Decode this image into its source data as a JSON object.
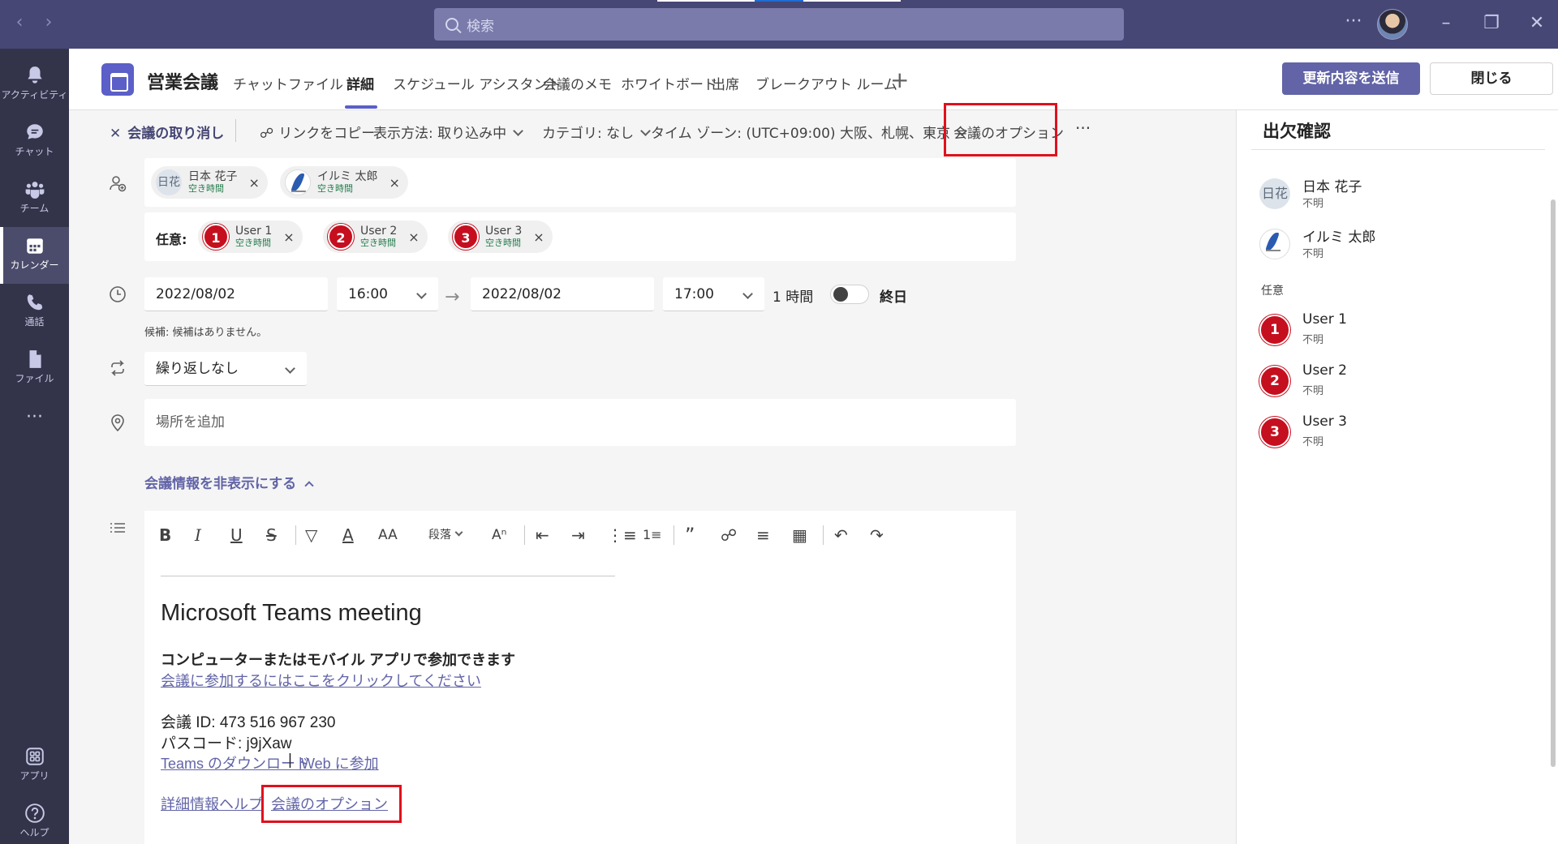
{
  "search": {
    "placeholder": "検索"
  },
  "rail": [
    {
      "label": "アクティビティ",
      "icon": "bell-icon"
    },
    {
      "label": "チャット",
      "icon": "chat-icon"
    },
    {
      "label": "チーム",
      "icon": "teams-icon"
    },
    {
      "label": "カレンダー",
      "icon": "calendar-icon"
    },
    {
      "label": "通話",
      "icon": "phone-icon"
    },
    {
      "label": "ファイル",
      "icon": "file-icon"
    },
    {
      "label": "アプリ",
      "icon": "apps-icon"
    },
    {
      "label": "ヘルプ",
      "icon": "help-icon"
    }
  ],
  "header": {
    "title": "営業会議",
    "tabs": [
      "チャット",
      "ファイル",
      "詳細",
      "スケジュール アシスタント",
      "会議のメモ",
      "ホワイトボード",
      "出席",
      "ブレークアウト ルーム"
    ],
    "active_tab": "詳細",
    "send_button": "更新内容を送信",
    "close_button": "閉じる"
  },
  "toolbar": {
    "cancel": "会議の取り消し",
    "copy_link": "リンクをコピー",
    "show_as": "表示方法: 取り込み中",
    "category": "カテゴリ: なし",
    "timezone": "タイム ゾーン: (UTC+09:00) 大阪、札幌、東京",
    "meeting_options": "会議のオプション",
    "more": "···"
  },
  "attendees": {
    "required": [
      {
        "initials": "日花",
        "name": "日本 花子",
        "status": "空き時間"
      },
      {
        "name": "イルミ 太郎",
        "status": "空き時間"
      }
    ],
    "optional_label": "任意:",
    "optional": [
      {
        "num": "1",
        "name": "User 1",
        "status": "空き時間"
      },
      {
        "num": "2",
        "name": "User 2",
        "status": "空き時間"
      },
      {
        "num": "3",
        "name": "User 3",
        "status": "空き時間"
      }
    ],
    "remove": "×"
  },
  "datetime": {
    "start_date": "2022/08/02",
    "start_time": "16:00",
    "arrow": "→",
    "end_date": "2022/08/02",
    "end_time": "17:00",
    "duration": "1 時間",
    "all_day": "終日",
    "all_day_on": false,
    "suggestion": "候補: 候補はありません。"
  },
  "repeat": {
    "value": "繰り返しなし"
  },
  "location": {
    "placeholder": "場所を追加"
  },
  "hide_info": "会議情報を非表示にする",
  "editor": {
    "paragraph": "段落",
    "meeting_title": "Microsoft Teams meeting",
    "join_desc": "コンピューターまたはモバイル アプリで参加できます",
    "join_link": "会議に参加するにはここをクリックしてください",
    "meeting_id": "会議 ID: 473 516 967 230",
    "passcode": "パスコード: j9jXaw",
    "download_link": "Teams のダウンロード",
    "pipe": "|",
    "web_link": "Web に参加",
    "help_link": "詳細情報ヘルプ",
    "options_link": "会議のオプション"
  },
  "rsvp": {
    "title": "出欠確認",
    "required": [
      {
        "initials": "日花",
        "name": "日本 花子",
        "status": "不明"
      },
      {
        "name": "イルミ 太郎",
        "status": "不明"
      }
    ],
    "optional_label": "任意",
    "optional": [
      {
        "num": "1",
        "name": "User 1",
        "status": "不明"
      },
      {
        "num": "2",
        "name": "User 2",
        "status": "不明"
      },
      {
        "num": "3",
        "name": "User 3",
        "status": "不明"
      }
    ]
  },
  "colors": {
    "brand": "#6264a7",
    "titlebar": "#464775",
    "rail": "#33344a",
    "highlight": "#e0101d",
    "available": "#237b4b"
  }
}
